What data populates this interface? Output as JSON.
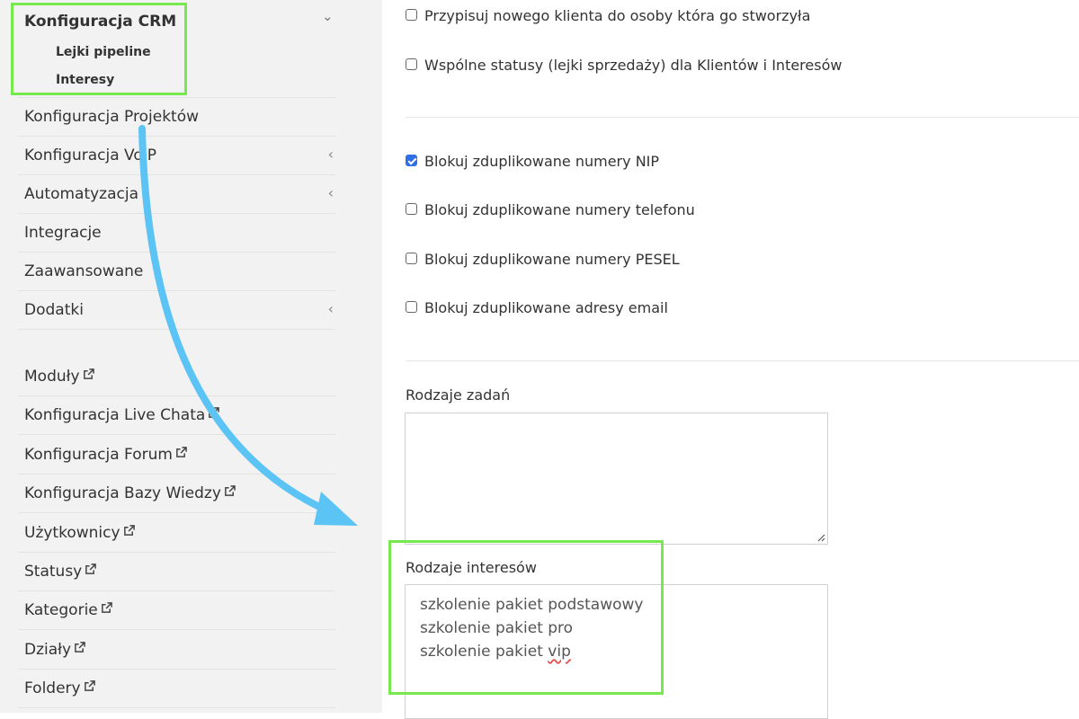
{
  "sidebar": {
    "crm": {
      "label": "Konfiguracja CRM",
      "subitems": [
        {
          "label": "Lejki pipeline"
        },
        {
          "label": "Interesy"
        }
      ]
    },
    "items": [
      {
        "label": "Konfiguracja Projektów",
        "chevron": false,
        "external": false
      },
      {
        "label": "Konfiguracja VoIP",
        "chevron": true,
        "external": false
      },
      {
        "label": "Automatyzacja",
        "chevron": true,
        "external": false
      },
      {
        "label": "Integracje",
        "chevron": false,
        "external": false
      },
      {
        "label": "Zaawansowane",
        "chevron": false,
        "external": false
      },
      {
        "label": "Dodatki",
        "chevron": true,
        "external": false
      }
    ],
    "external_items": [
      {
        "label": "Moduły"
      },
      {
        "label": "Konfiguracja Live Chata"
      },
      {
        "label": "Konfiguracja Forum"
      },
      {
        "label": "Konfiguracja Bazy Wiedzy"
      },
      {
        "label": "Użytkownicy"
      },
      {
        "label": "Statusy"
      },
      {
        "label": "Kategorie"
      },
      {
        "label": "Działy"
      },
      {
        "label": "Foldery"
      }
    ]
  },
  "main": {
    "checkboxes_top": [
      {
        "label": "Przypisuj nowego klienta do osoby która go stworzyła",
        "checked": false
      },
      {
        "label": "Wspólne statusy (lejki sprzedaży) dla Klientów i Interesów",
        "checked": false
      }
    ],
    "checkboxes_dup": [
      {
        "label": "Blokuj zduplikowane numery NIP",
        "checked": true
      },
      {
        "label": "Blokuj zduplikowane numery telefonu",
        "checked": false
      },
      {
        "label": "Blokuj zduplikowane numery PESEL",
        "checked": false
      },
      {
        "label": "Blokuj zduplikowane adresy email",
        "checked": false
      }
    ],
    "task_types": {
      "label": "Rodzaje zadań",
      "value": ""
    },
    "interest_types": {
      "label": "Rodzaje interesów",
      "lines": [
        "szkolenie pakiet podstawowy",
        "szkolenie pakiet pro",
        "szkolenie pakiet "
      ],
      "misspelled_word": "vip"
    }
  },
  "colors": {
    "highlight": "#77e84e",
    "arrow": "#5bc4f4",
    "checkbox_checked": "#2f6fe6",
    "sidebar_bg": "#f2f2f2"
  }
}
